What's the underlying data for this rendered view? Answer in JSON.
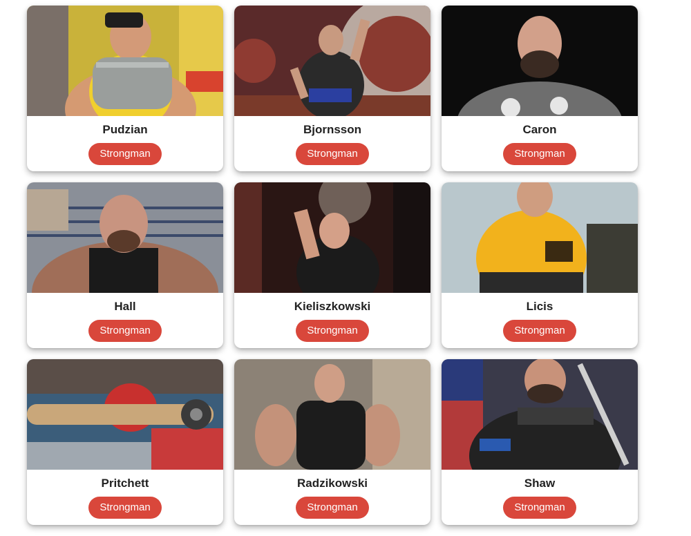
{
  "colors": {
    "tag_background": "#d9473b",
    "tag_text": "#ffffff",
    "card_background": "#ffffff",
    "name_text": "#222222"
  },
  "cards": [
    {
      "name": "Pudzian",
      "tag": "Strongman",
      "photo_alt": "Pudzian photo"
    },
    {
      "name": "Bjornsson",
      "tag": "Strongman",
      "photo_alt": "Bjornsson photo"
    },
    {
      "name": "Caron",
      "tag": "Strongman",
      "photo_alt": "Caron photo"
    },
    {
      "name": "Hall",
      "tag": "Strongman",
      "photo_alt": "Hall photo"
    },
    {
      "name": "Kieliszkowski",
      "tag": "Strongman",
      "photo_alt": "Kieliszkowski photo"
    },
    {
      "name": "Licis",
      "tag": "Strongman",
      "photo_alt": "Licis photo"
    },
    {
      "name": "Pritchett",
      "tag": "Strongman",
      "photo_alt": "Pritchett photo"
    },
    {
      "name": "Radzikowski",
      "tag": "Strongman",
      "photo_alt": "Radzikowski photo"
    },
    {
      "name": "Shaw",
      "tag": "Strongman",
      "photo_alt": "Shaw photo"
    }
  ]
}
